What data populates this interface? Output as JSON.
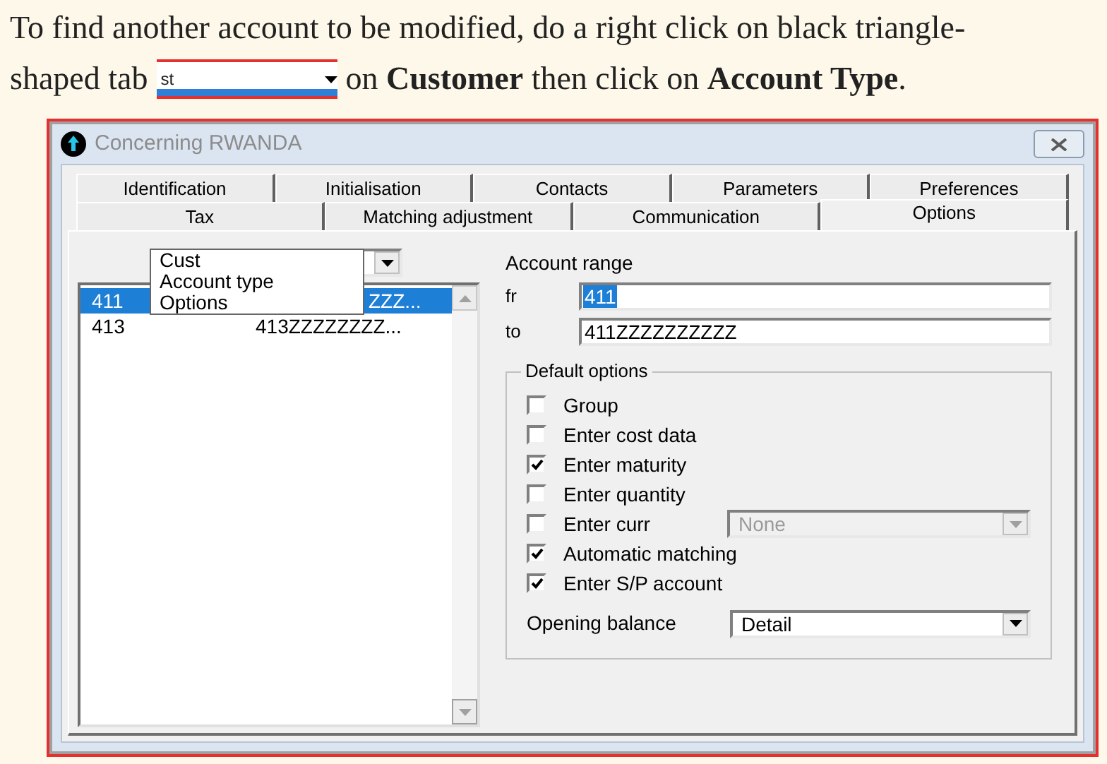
{
  "instruction": {
    "line_1": "To find another account to be modified, do a right click on black triangle-",
    "text_before": "shaped tab",
    "snippet_value": "st",
    "text_after": "on **Customer** then click on **Account Type**."
  },
  "window": {
    "title": "Concerning RWANDA"
  },
  "tab_rows": [
    [
      {
        "label": "Identification",
        "selected": false
      },
      {
        "label": "Initialisation",
        "selected": false
      },
      {
        "label": "Contacts",
        "selected": false
      },
      {
        "label": "Parameters",
        "selected": false
      },
      {
        "label": "Preferences",
        "selected": false
      }
    ],
    [
      {
        "label": "Tax",
        "selected": false
      },
      {
        "label": "Matching adjustment",
        "selected": false
      },
      {
        "label": "Communication",
        "selected": false
      },
      {
        "label": "Options",
        "selected": true
      }
    ]
  ],
  "filter_dropdown": {
    "expanded": true,
    "options": [
      "Cust",
      "Account type",
      "Options"
    ]
  },
  "account_list": {
    "rows": [
      {
        "cells": [
          "411",
          "ZZZ..."
        ],
        "selected": true
      },
      {
        "cells": [
          "413",
          "413ZZZZZZZZ..."
        ],
        "selected": false
      }
    ]
  },
  "account_range": {
    "label": "Account range",
    "fields": [
      {
        "label": "fr",
        "value": "411",
        "selected": true
      },
      {
        "label": "to",
        "value": "411ZZZZZZZZZZ",
        "selected": false
      }
    ]
  },
  "default_options": {
    "title": "Default options",
    "checkboxes": [
      {
        "label": "Group",
        "checked": false
      },
      {
        "label": "Enter cost data",
        "checked": false
      },
      {
        "label": "Enter maturity",
        "checked": true
      },
      {
        "label": "Enter quantity",
        "checked": false
      },
      {
        "label": "Enter curr",
        "checked": false,
        "combo": {
          "value": "None",
          "disabled": true
        }
      },
      {
        "label": "Automatic matching",
        "checked": true
      },
      {
        "label": "Enter S/P account",
        "checked": true
      }
    ],
    "opening_balance": {
      "label": "Opening balance",
      "value": "Detail",
      "disabled": false
    }
  }
}
